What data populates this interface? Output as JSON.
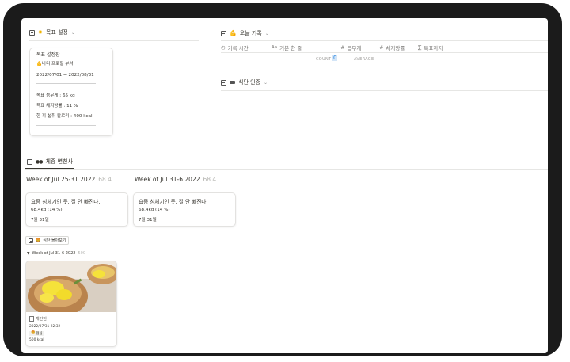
{
  "goal_section": {
    "icon": "sun-emoji",
    "title": "목표 설정",
    "card": {
      "title": "목표 설정장",
      "line1": "💪바디 프로필 부셔!",
      "dates": "2022/07/01 → 2022/08/31",
      "separator": "―――――――――――――――",
      "weight": "목표 몸무게 : 65 kg",
      "bodyfat": "목표 체지방률 : 11 %",
      "kcal": "한 끼 섭취 칼로리 : 400 kcal",
      "separator2": "―――――――――――――――"
    }
  },
  "today_record": {
    "emoji": "💪",
    "title": "오늘 기록",
    "columns": [
      {
        "icon": "clock-icon",
        "label": "기록 시간"
      },
      {
        "icon": "text-icon",
        "label": "기분 한 줄"
      },
      {
        "icon": "number-icon",
        "label": "몸무게"
      },
      {
        "icon": "number-icon",
        "label": "체지방률"
      },
      {
        "icon": "sigma-icon",
        "label": "목표까지"
      }
    ],
    "count_label": "COUNT",
    "count_value": "0",
    "average_label": "AVERAGE"
  },
  "meal_proof": {
    "emoji": "🍱",
    "title": "식단 인증"
  },
  "weight_changes": {
    "emoji": "👀",
    "title": "체중 변천사",
    "weeks": [
      {
        "title": "Week of Jul 25-31 2022",
        "count": "68.4",
        "card_title": "요즘 침체기인 듯. 잘 안 빠진다.",
        "card_weight": "68.4kg (14 %)",
        "card_date": "7월 31일"
      },
      {
        "title": "Week of Jul 31-6 2022",
        "count": "68.4",
        "card_title": "요즘 침체기인 듯. 잘 안 빠진다.",
        "card_weight": "68.4kg (14 %)",
        "card_date": "7월 31일"
      }
    ]
  },
  "meal_gallery": {
    "emoji": "🍔",
    "tab_label": "식단 몰아보기",
    "group_title": "Week of Jul 31-6 2022",
    "group_count": "500",
    "item": {
      "name": "개인현",
      "datetime": "2022/07/31 22:32",
      "tag_emoji": "🍔",
      "tag": "점심",
      "kcal": "500 kcal"
    }
  }
}
